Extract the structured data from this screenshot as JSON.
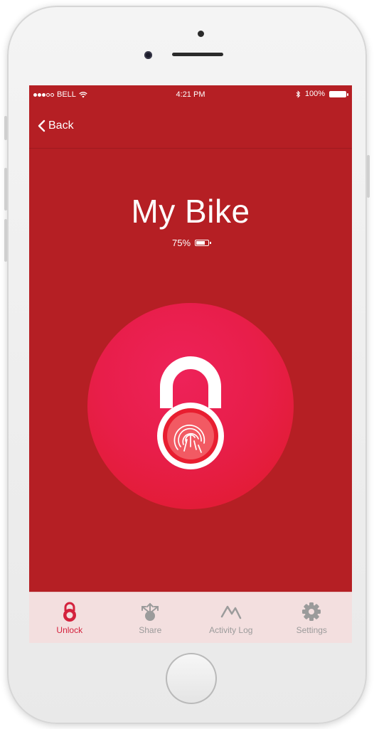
{
  "status_bar": {
    "carrier": "BELL",
    "time": "4:21 PM",
    "battery": "100%",
    "icons": [
      "signal-dots-icon",
      "wifi-icon",
      "bluetooth-icon",
      "battery-icon"
    ]
  },
  "nav": {
    "back_label": "Back",
    "back_icon": "chevron-left-icon"
  },
  "device_info": {
    "name": "My Bike",
    "battery_label": "75%",
    "battery_level": 0.75
  },
  "unlock_control": {
    "icon": "fingerprint-lock-icon"
  },
  "tab_bar": {
    "items": [
      {
        "label": "Unlock",
        "icon": "lock-icon",
        "active": true
      },
      {
        "label": "Share",
        "icon": "share-icon",
        "active": false
      },
      {
        "label": "Activity Log",
        "icon": "activity-icon",
        "active": false
      },
      {
        "label": "Settings",
        "icon": "gear-icon",
        "active": false
      }
    ]
  },
  "colors": {
    "background": "#b51f24",
    "accent": "#e81e4a",
    "active_tab": "#d4223d",
    "inactive_tab": "#9b9b9b",
    "tab_bar_bg": "#f3dfdf"
  }
}
